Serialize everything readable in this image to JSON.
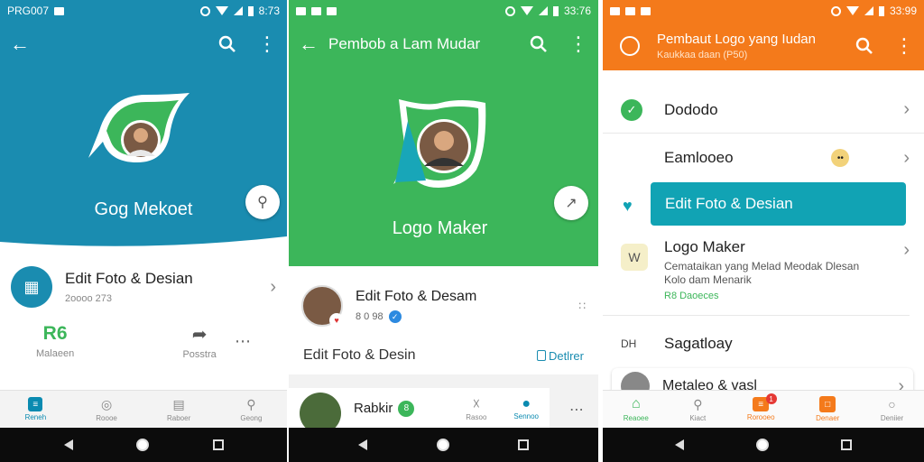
{
  "colors": {
    "teal": "#1a8cb0",
    "green": "#3cb65a",
    "orange": "#f47a1b",
    "cyan_highlight": "#11a3b4",
    "dark_nav": "#0c0c0c"
  },
  "phone1": {
    "status": {
      "left_text": "PRG007",
      "time": "8:73"
    },
    "app_name": "Gog Mekoet",
    "card": {
      "title": "Edit Foto & Desian",
      "meta": "2oooo 273"
    },
    "stats": [
      {
        "value": "R6",
        "label": "Malaeen"
      },
      {
        "value": "",
        "label": "Posstra"
      }
    ],
    "tabs": [
      {
        "label": "Reneh",
        "icon": "chat-icon"
      },
      {
        "label": "Roooe",
        "icon": "shield-icon"
      },
      {
        "label": "Raboer",
        "icon": "book-icon"
      },
      {
        "label": "Geong",
        "icon": "search-icon"
      }
    ]
  },
  "phone2": {
    "status": {
      "time": "33:76"
    },
    "title": "Pembob a Lam Mudar",
    "app_name": "Logo Maker",
    "card": {
      "title": "Edit Foto & Desam",
      "meta": "8 0 98"
    },
    "footer_left": "Edit Foto & Desin",
    "footer_right": "Detlrer",
    "list_item": {
      "title": "Rabkir",
      "badge": "8"
    },
    "tabs": [
      {
        "label": "Rabkir"
      },
      {
        "label": "Rasoo"
      },
      {
        "label": "Sennoo"
      }
    ]
  },
  "phone3": {
    "status": {
      "time": "33:99"
    },
    "title": "Pembaut Logo yang Iudan",
    "subtitle": "Kaukkaa daan (P50)",
    "items": [
      {
        "label": "Dododo"
      },
      {
        "label": "Eamlooeo"
      },
      {
        "label": "Edit Foto & Desian"
      },
      {
        "label": "Logo Maker",
        "desc": "Cemataikan yang Melad Meodak Dlesan Kolo dam Menarik",
        "meta": "R8 Daoeces"
      },
      {
        "label": "Sagatloay",
        "prefix": "DH"
      },
      {
        "label": "Metaleo & vasl"
      }
    ],
    "tabs": [
      {
        "label": "Reaoee"
      },
      {
        "label": "Kiact"
      },
      {
        "label": "Rorooeo",
        "badge": "1"
      },
      {
        "label": "Denaer"
      },
      {
        "label": "Deniier"
      }
    ]
  }
}
